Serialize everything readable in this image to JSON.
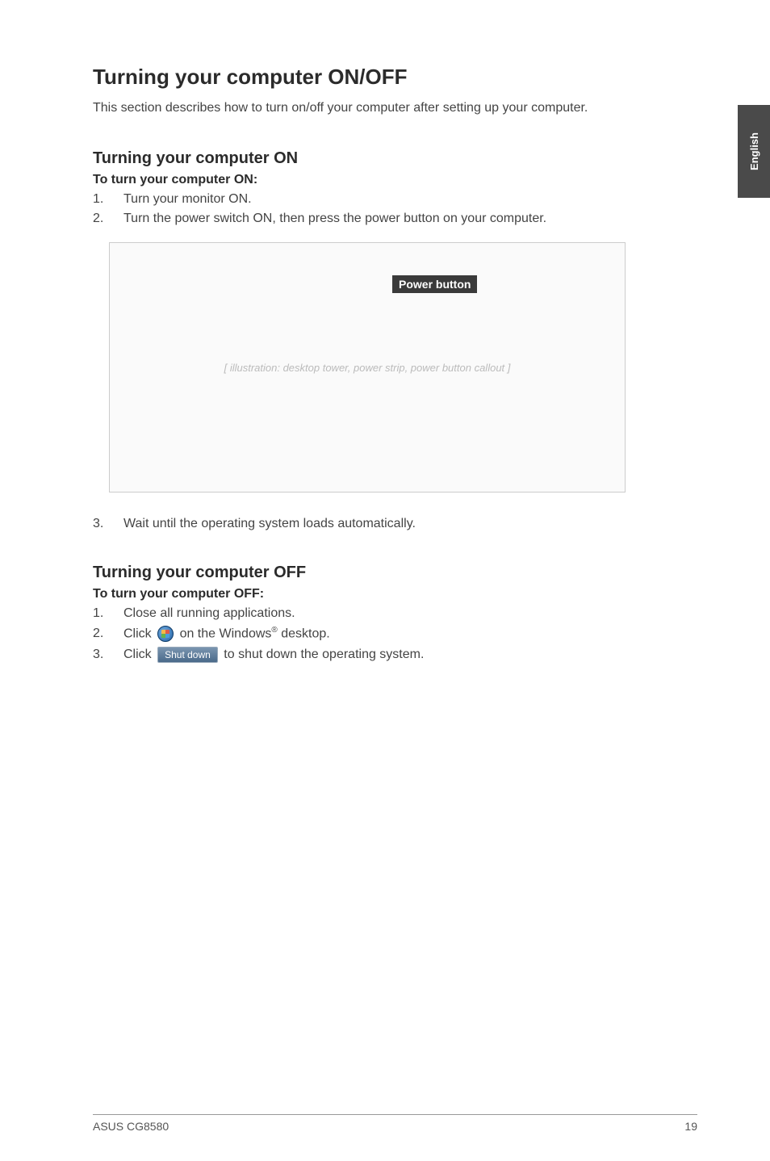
{
  "side_tab": "English",
  "title": "Turning your computer ON/OFF",
  "intro": "This section describes how to turn on/off your computer after setting up your computer.",
  "on": {
    "heading": "Turning your computer ON",
    "subheading": "To turn your computer ON:",
    "steps": {
      "n1": "1.",
      "s1": "Turn your monitor ON.",
      "n2": "2.",
      "s2": "Turn the power switch ON, then press the power button on your computer.",
      "n3": "3.",
      "s3": "Wait until the operating system loads automatically."
    }
  },
  "figure": {
    "power_button_label": "Power button",
    "placeholder": "[ illustration: desktop tower, power strip, power button callout ]"
  },
  "off": {
    "heading": "Turning your computer OFF",
    "subheading": "To turn your computer OFF:",
    "steps": {
      "n1": "1.",
      "s1": "Close all running applications.",
      "n2": "2.",
      "s2a": "Click ",
      "s2b": " on the Windows",
      "s2sup": "®",
      "s2c": " desktop.",
      "n3": "3.",
      "s3a": "Click ",
      "shutdown_label": "Shut down",
      "s3b": " to shut down the operating system."
    }
  },
  "footer": {
    "left": "ASUS CG8580",
    "right": "19"
  }
}
